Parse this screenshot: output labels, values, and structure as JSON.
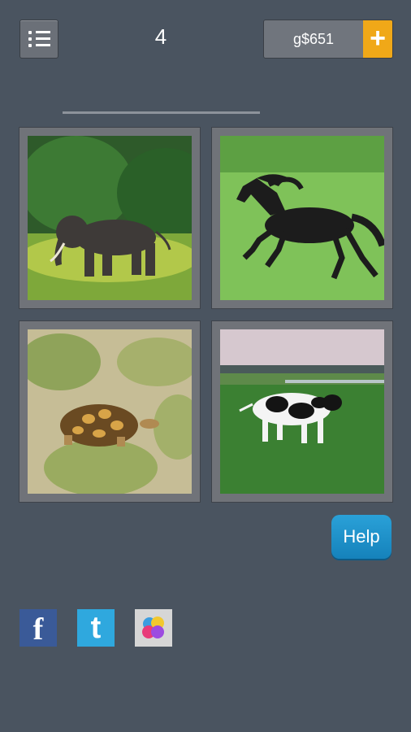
{
  "header": {
    "level": "4",
    "coins": "g$651",
    "add_coins_symbol": "+"
  },
  "tiles": [
    {
      "animal": "elephant"
    },
    {
      "animal": "horse"
    },
    {
      "animal": "tortoise"
    },
    {
      "animal": "cow"
    }
  ],
  "help_label": "Help",
  "social": {
    "facebook": "f",
    "twitter": "t"
  },
  "colors": {
    "background": "#4a5460",
    "coin_add": "#f0a818",
    "help_button": "#1e90c8"
  }
}
